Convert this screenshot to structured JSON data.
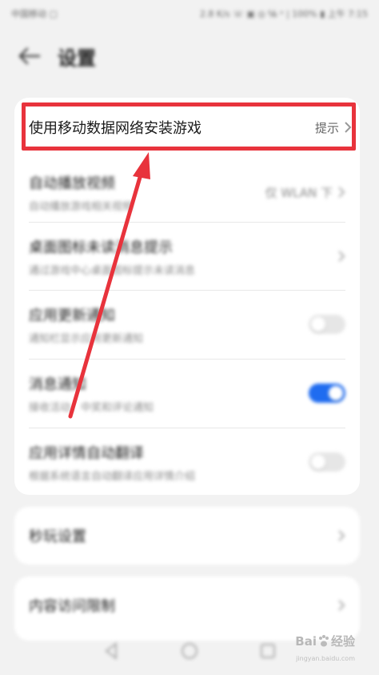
{
  "status_bar": {
    "carrier": "中国移动 ▢",
    "right": "2.8 K/s ☏ ▣ ◎ ℅ ᵊ | 100% ▮ 上午 7:15"
  },
  "header": {
    "title": "设置",
    "back_icon": "arrow-left-icon"
  },
  "highlighted_row": {
    "title": "使用移动数据网络安装游戏",
    "value": "提示"
  },
  "rows": [
    {
      "title": "自动播放视频",
      "sub": "自动播放游戏相关视频",
      "value": "仅 WLAN 下",
      "control": "chevron"
    },
    {
      "title": "桌面图标未读消息提示",
      "sub": "通过游戏中心桌面图标提示未读消息",
      "value": "",
      "control": "chevron"
    },
    {
      "title": "应用更新通知",
      "sub": "通知栏显示应用更新通知",
      "value": "",
      "control": "toggle",
      "on": false
    },
    {
      "title": "消息通知",
      "sub": "接收活动、中奖和评论通知",
      "value": "",
      "control": "toggle",
      "on": true
    },
    {
      "title": "应用详情自动翻译",
      "sub": "根据系统语言自动翻译应用详情介绍",
      "value": "",
      "control": "toggle",
      "on": false
    }
  ],
  "cards": [
    {
      "title": "秒玩设置"
    },
    {
      "title": "内容访问限制"
    }
  ],
  "watermark": {
    "brand": "Bai",
    "suffix": "经验",
    "sub": "jingyan.baidu.com"
  },
  "colors": {
    "accent": "#1f6cf0",
    "highlight": "#e8333c",
    "background": "#f2f2f2"
  }
}
